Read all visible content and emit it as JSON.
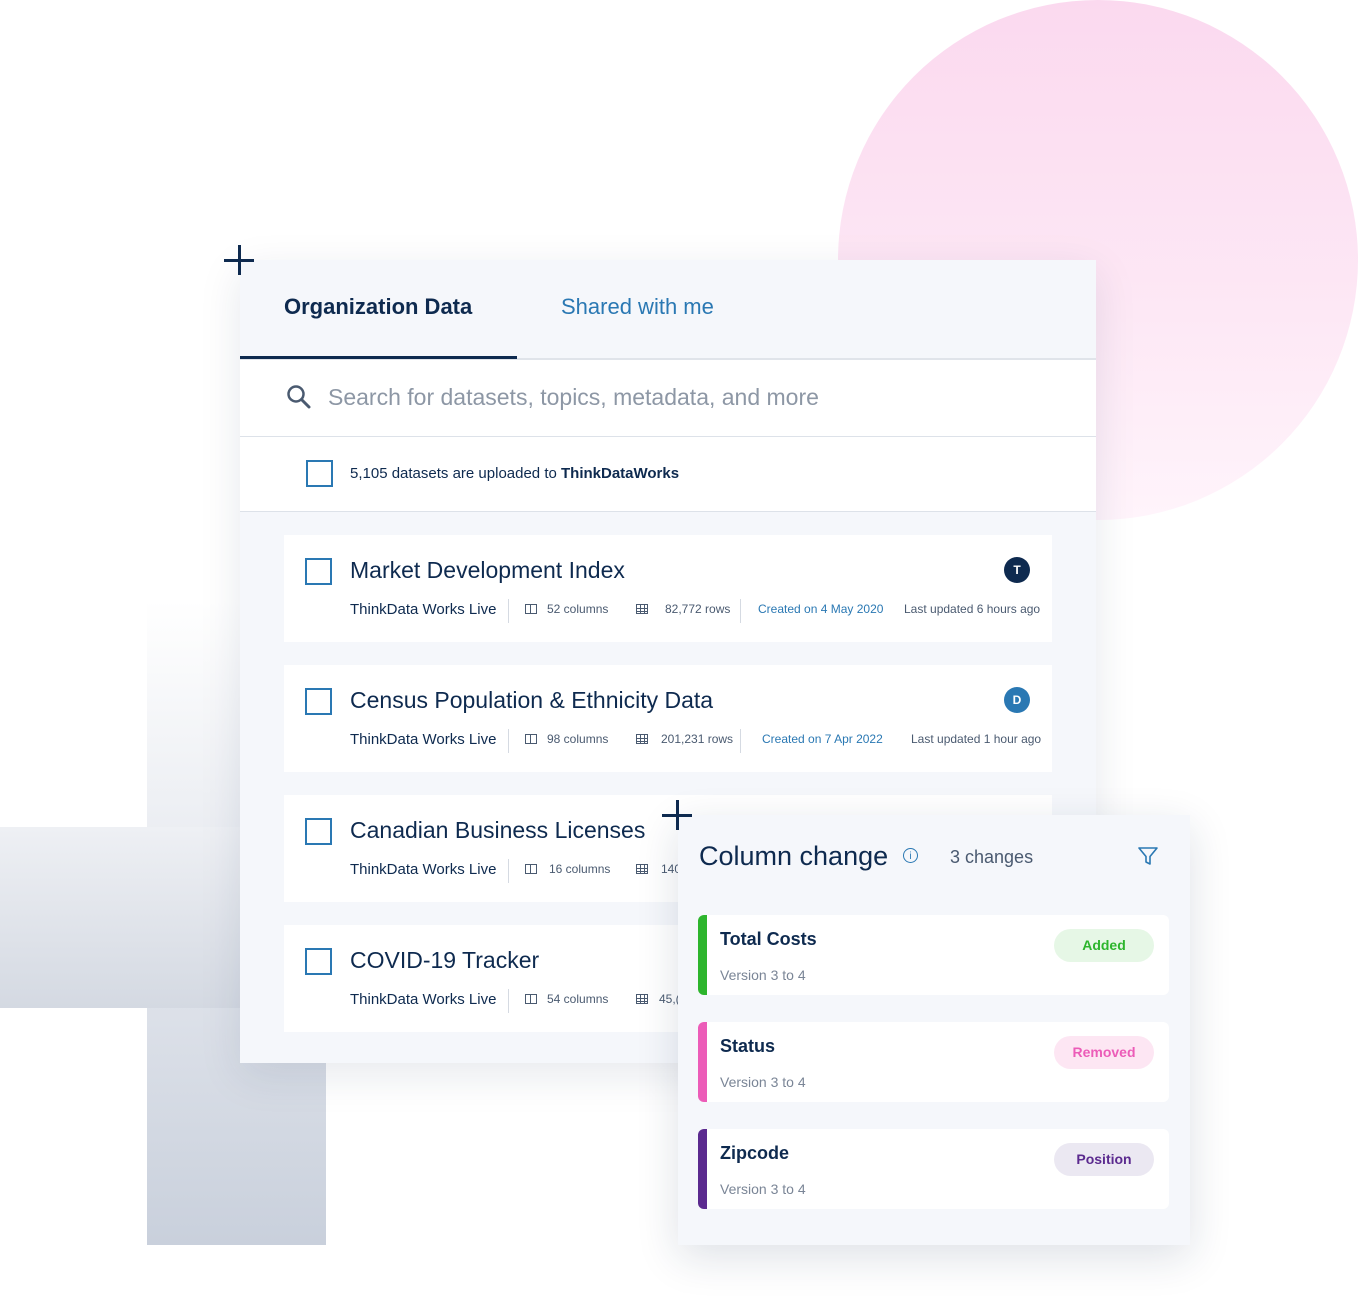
{
  "tabs": {
    "organization": "Organization Data",
    "shared": "Shared with me"
  },
  "search": {
    "placeholder": "Search for datasets, topics, metadata, and more"
  },
  "summary": {
    "prefix": "5,105 datasets are uploaded to ",
    "org": "ThinkDataWorks"
  },
  "datasets": [
    {
      "title": "Market Development Index",
      "source": "ThinkData Works Live",
      "columns": "52 columns",
      "rows": "82,772 rows",
      "created_label": "Created on",
      "created_date": "4 May 2020",
      "updated": "Last updated 6 hours ago",
      "avatar": "T",
      "avatar_color": "#0e2a4f"
    },
    {
      "title": "Census Population & Ethnicity Data",
      "source": "ThinkData Works Live",
      "columns": "98 columns",
      "rows": "201,231 rows",
      "created_label": "Created on",
      "created_date": "7 Apr 2022",
      "updated": "Last updated 1 hour ago",
      "avatar": "D",
      "avatar_color": "#2a78b3"
    },
    {
      "title": "Canadian Business Licenses",
      "source": "ThinkData Works Live",
      "columns": "16 columns",
      "rows": "140"
    },
    {
      "title": "COVID-19 Tracker",
      "source": "ThinkData Works Live",
      "columns": "54 columns",
      "rows": "45,("
    }
  ],
  "column_change": {
    "title": "Column change",
    "info_symbol": "i",
    "count": "3 changes",
    "items": [
      {
        "name": "Total Costs",
        "version": "Version 3 to 4",
        "status": "Added",
        "bar_color": "#2db52d",
        "pill_bg": "#e6f7e6",
        "pill_color": "#2db52d"
      },
      {
        "name": "Status",
        "version": "Version 3 to 4",
        "status": "Removed",
        "bar_color": "#ec5cb8",
        "pill_bg": "#fde6f3",
        "pill_color": "#ec5cb8"
      },
      {
        "name": "Zipcode",
        "version": "Version 3 to 4",
        "status": "Position",
        "bar_color": "#5b2a8f",
        "pill_bg": "#ebe8f2",
        "pill_color": "#5b2a8f"
      }
    ]
  },
  "colors": {
    "navy": "#0e2a4f",
    "accent_blue": "#2a78b3",
    "pink": "#fbd9ef"
  }
}
